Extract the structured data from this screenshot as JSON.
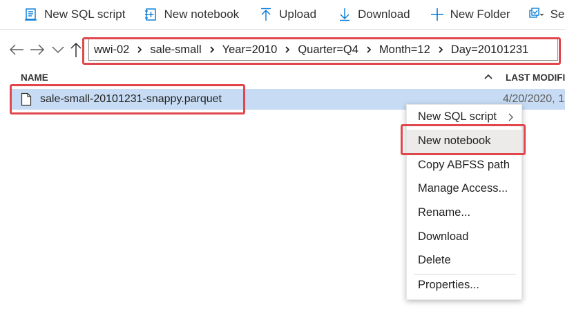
{
  "toolbar": {
    "new_sql_script": "New SQL script",
    "new_notebook": "New notebook",
    "upload": "Upload",
    "download": "Download",
    "new_folder": "New Folder",
    "select_all": "Select A"
  },
  "breadcrumb": [
    "wwi-02",
    "sale-small",
    "Year=2010",
    "Quarter=Q4",
    "Month=12",
    "Day=20101231"
  ],
  "columns": {
    "name": "NAME",
    "last_modified": "LAST MODIFI"
  },
  "files": [
    {
      "name": "sale-small-20101231-snappy.parquet",
      "last_modified": "4/20/2020, 1"
    }
  ],
  "context_menu": {
    "items": [
      "New SQL script",
      "New notebook",
      "Copy ABFSS path",
      "Manage Access...",
      "Rename...",
      "Download",
      "Delete",
      "Properties..."
    ],
    "highlighted": "New notebook"
  },
  "highlight_color": "#e0474c",
  "selection_color": "#c7dcf4"
}
